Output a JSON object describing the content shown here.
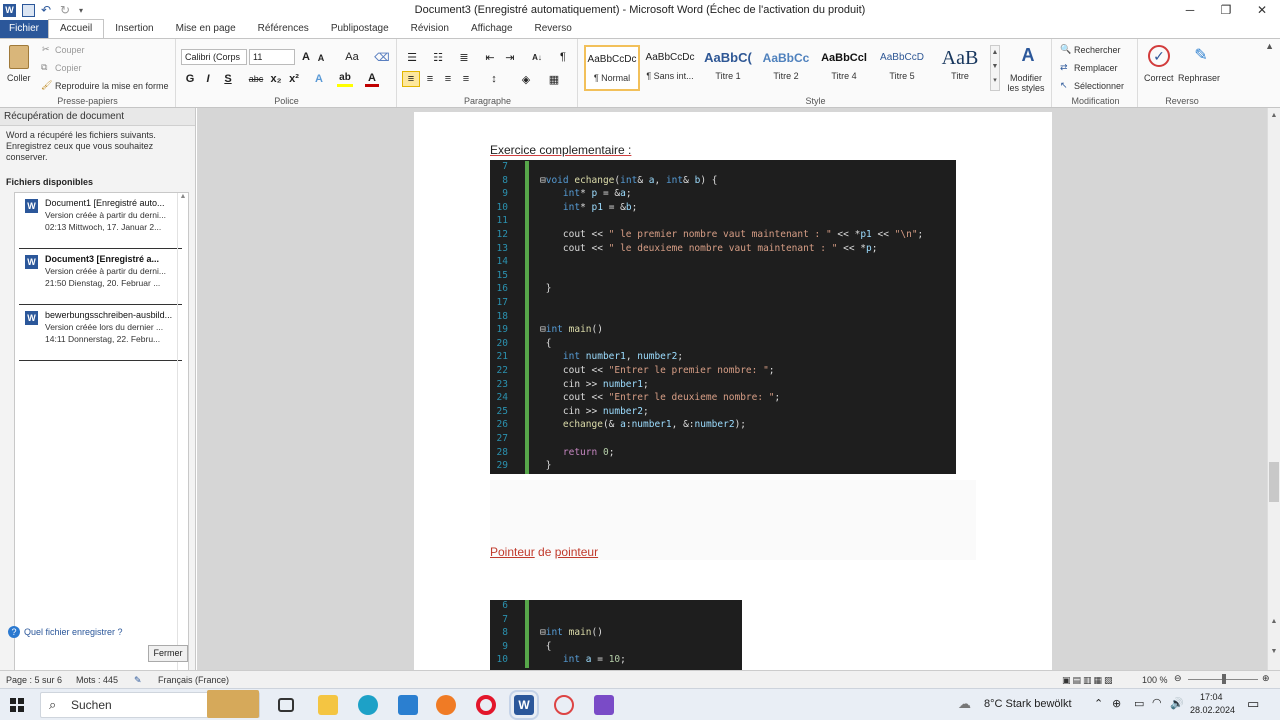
{
  "window": {
    "title": "Document3 (Enregistré automatiquement)  -  Microsoft Word (Échec de l'activation du produit)"
  },
  "tabs": [
    "Fichier",
    "Accueil",
    "Insertion",
    "Mise en page",
    "Références",
    "Publipostage",
    "Révision",
    "Affichage",
    "Reverso"
  ],
  "ribbon": {
    "clipboard": {
      "paste": "Coller",
      "cut": "Couper",
      "copy": "Copier",
      "format": "Reproduire la mise en forme",
      "label": "Presse-papiers"
    },
    "font": {
      "name": "Calibri (Corps",
      "size": "11",
      "label": "Police"
    },
    "paragraph": {
      "label": "Paragraphe"
    },
    "styles": {
      "label": "Style",
      "items": [
        {
          "preview": "AaBbCcDc",
          "name": "¶ Normal"
        },
        {
          "preview": "AaBbCcDc",
          "name": "¶ Sans int..."
        },
        {
          "preview": "AaBbC(",
          "name": "Titre 1"
        },
        {
          "preview": "AaBbCc",
          "name": "Titre 2"
        },
        {
          "preview": "AaBbCcl",
          "name": "Titre 4"
        },
        {
          "preview": "AaBbCcD",
          "name": "Titre 5"
        },
        {
          "preview": "AaB",
          "name": "Titre"
        }
      ],
      "modify": "Modifier les styles"
    },
    "editing": {
      "find": "Rechercher",
      "replace": "Remplacer",
      "select": "Sélectionner",
      "label": "Modification"
    },
    "reverso": {
      "correct": "Correct",
      "rephrase": "Rephraser",
      "label": "Reverso"
    }
  },
  "recovery": {
    "header": "Récupération de document",
    "message": "Word a récupéré les fichiers suivants. Enregistrez ceux que vous souhaitez conserver.",
    "available": "Fichiers disponibles",
    "files": [
      {
        "name": "Document1  [Enregistré auto...",
        "line1": "Version créée à partir du derni...",
        "line2": "02:13 Mittwoch, 17. Januar 2..."
      },
      {
        "name": "Document3  [Enregistré a...",
        "line1": "Version créée à partir du derni...",
        "line2": "21:50 Dienstag, 20. Februar ..."
      },
      {
        "name": "bewerbungsschreiben-ausbild...",
        "line1": "Version créée lors du dernier ...",
        "line2": "14:11 Donnerstag, 22. Febru..."
      }
    ],
    "help": "Quel fichier enregistrer ?",
    "close": "Fermer"
  },
  "doc": {
    "heading1": "Exercice complementaire :",
    "heading2_part1": "Pointeur",
    "heading2_part2": " de ",
    "heading2_part3": "pointeur",
    "code1": [
      {
        "n": "7",
        "t": ""
      },
      {
        "n": "8",
        "t": "⊟void echange(int& a, int& b) {"
      },
      {
        "n": "9",
        "t": "    int* p = &a;"
      },
      {
        "n": "10",
        "t": "    int* p1 = &b;"
      },
      {
        "n": "11",
        "t": ""
      },
      {
        "n": "12",
        "t": "    cout << \" le premier nombre vaut maintenant : \" << *p1 << \"\\n\";"
      },
      {
        "n": "13",
        "t": "    cout << \" le deuxieme nombre vaut maintenant : \" << *p;"
      },
      {
        "n": "14",
        "t": ""
      },
      {
        "n": "15",
        "t": ""
      },
      {
        "n": "16",
        "t": " }"
      },
      {
        "n": "17",
        "t": ""
      },
      {
        "n": "18",
        "t": ""
      },
      {
        "n": "19",
        "t": "⊟int main()"
      },
      {
        "n": "20",
        "t": " {"
      },
      {
        "n": "21",
        "t": "    int number1, number2;"
      },
      {
        "n": "22",
        "t": "    cout << \"Entrer le premier nombre: \";"
      },
      {
        "n": "23",
        "t": "    cin >> number1;"
      },
      {
        "n": "24",
        "t": "    cout << \"Entrer le deuxieme nombre: \";"
      },
      {
        "n": "25",
        "t": "    cin >> number2;"
      },
      {
        "n": "26",
        "t": "    echange(& a:number1, &:number2);"
      },
      {
        "n": "27",
        "t": ""
      },
      {
        "n": "28",
        "t": "    return 0;"
      },
      {
        "n": "29",
        "t": " }"
      }
    ],
    "code2": [
      {
        "n": "6",
        "t": ""
      },
      {
        "n": "7",
        "t": ""
      },
      {
        "n": "8",
        "t": "⊟int main()"
      },
      {
        "n": "9",
        "t": " {"
      },
      {
        "n": "10",
        "t": "    int a = 10;"
      }
    ]
  },
  "status": {
    "page": "Page : 5 sur 6",
    "words": "Mots : 445",
    "lang": "Français (France)",
    "zoom": "100 %"
  },
  "taskbar": {
    "search": "Suchen",
    "weather": "8°C  Stark bewölkt",
    "time": "17:04",
    "date": "28.02.2024"
  },
  "colors": {
    "accent": "#2b579a",
    "code_bg": "#1e1e1e",
    "keyword": "#569cd6",
    "string": "#d69d85",
    "linenum": "#2b91af",
    "change_bar": "#57a64a"
  }
}
